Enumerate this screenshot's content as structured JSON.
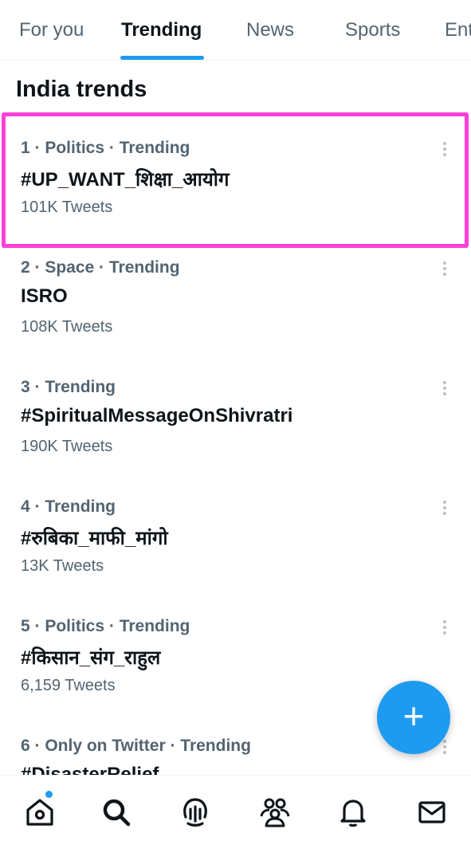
{
  "tabs": [
    {
      "label": "For you"
    },
    {
      "label": "Trending"
    },
    {
      "label": "News"
    },
    {
      "label": "Sports"
    },
    {
      "label": "Ent"
    }
  ],
  "section_title": "India trends",
  "trends": [
    {
      "meta": "1 · Politics · Trending",
      "name": "#UP_WANT_शिक्षा_आयोग",
      "count": "101K Tweets"
    },
    {
      "meta": "2 · Space · Trending",
      "name": "ISRO",
      "count": "108K Tweets"
    },
    {
      "meta": "3 · Trending",
      "name": "#SpiritualMessageOnShivratri",
      "count": "190K Tweets"
    },
    {
      "meta": "4 · Trending",
      "name": "#रुबिका_माफी_मांगो",
      "count": "13K Tweets"
    },
    {
      "meta": "5 · Politics · Trending",
      "name": "#किसान_संग_राहुल",
      "count": "6,159 Tweets"
    },
    {
      "meta": "6 · Only on Twitter · Trending",
      "name": "#DisasterRelief",
      "count": ""
    }
  ],
  "fab": {
    "label": "+"
  },
  "colors": {
    "accent": "#1d9bf0",
    "highlight": "#ff3fd8",
    "secondary_text": "#536471"
  },
  "nav_icons": [
    "home-icon",
    "search-icon",
    "spaces-icon",
    "communities-icon",
    "notifications-icon",
    "messages-icon"
  ]
}
